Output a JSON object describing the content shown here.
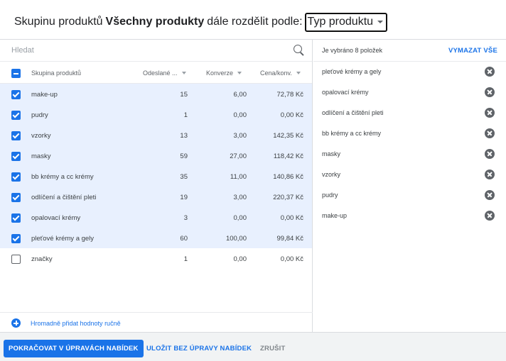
{
  "header": {
    "prefix": "Skupinu produktů",
    "bold": "Všechny produkty",
    "middle": "dále rozdělit podle:",
    "dropdown_value": "Typ produktu"
  },
  "search": {
    "placeholder": "Hledat"
  },
  "table": {
    "columns": {
      "name": "Skupina produktů",
      "sent": "Odeslané ...",
      "conversions": "Konverze",
      "price": "Cena/konv."
    },
    "rows": [
      {
        "name": "make-up",
        "sent": "15",
        "conversions": "6,00",
        "price": "72,78 Kč",
        "checked": true
      },
      {
        "name": "pudry",
        "sent": "1",
        "conversions": "0,00",
        "price": "0,00 Kč",
        "checked": true
      },
      {
        "name": "vzorky",
        "sent": "13",
        "conversions": "3,00",
        "price": "142,35 Kč",
        "checked": true
      },
      {
        "name": "masky",
        "sent": "59",
        "conversions": "27,00",
        "price": "118,42 Kč",
        "checked": true
      },
      {
        "name": "bb krémy a cc krémy",
        "sent": "35",
        "conversions": "11,00",
        "price": "140,86 Kč",
        "checked": true
      },
      {
        "name": "odlíčení a čištění pleti",
        "sent": "19",
        "conversions": "3,00",
        "price": "220,37 Kč",
        "checked": true
      },
      {
        "name": "opalovací krémy",
        "sent": "3",
        "conversions": "0,00",
        "price": "0,00 Kč",
        "checked": true
      },
      {
        "name": "pleťové krémy a gely",
        "sent": "60",
        "conversions": "100,00",
        "price": "99,84 Kč",
        "checked": true
      },
      {
        "name": "značky",
        "sent": "1",
        "conversions": "0,00",
        "price": "0,00 Kč",
        "checked": false
      }
    ]
  },
  "add_manual": "Hromadně přidat hodnoty ručně",
  "selected": {
    "count_label": "Je vybráno 8 položek",
    "clear_label": "VYMAZAT VŠE",
    "items": [
      "pleťové krémy a gely",
      "opalovací krémy",
      "odlíčení a čištění pleti",
      "bb krémy a cc krémy",
      "masky",
      "vzorky",
      "pudry",
      "make-up"
    ]
  },
  "footer": {
    "continue_label": "POKRAČOVAT V ÚPRAVÁCH NABÍDEK",
    "save_label": "ULOŽIT BEZ ÚPRAVY NABÍDEK",
    "cancel_label": "ZRUŠIT"
  },
  "colors": {
    "accent": "#1a73e8",
    "selected_row": "#e8f0fe",
    "footer_bg": "#f1f3f4"
  }
}
